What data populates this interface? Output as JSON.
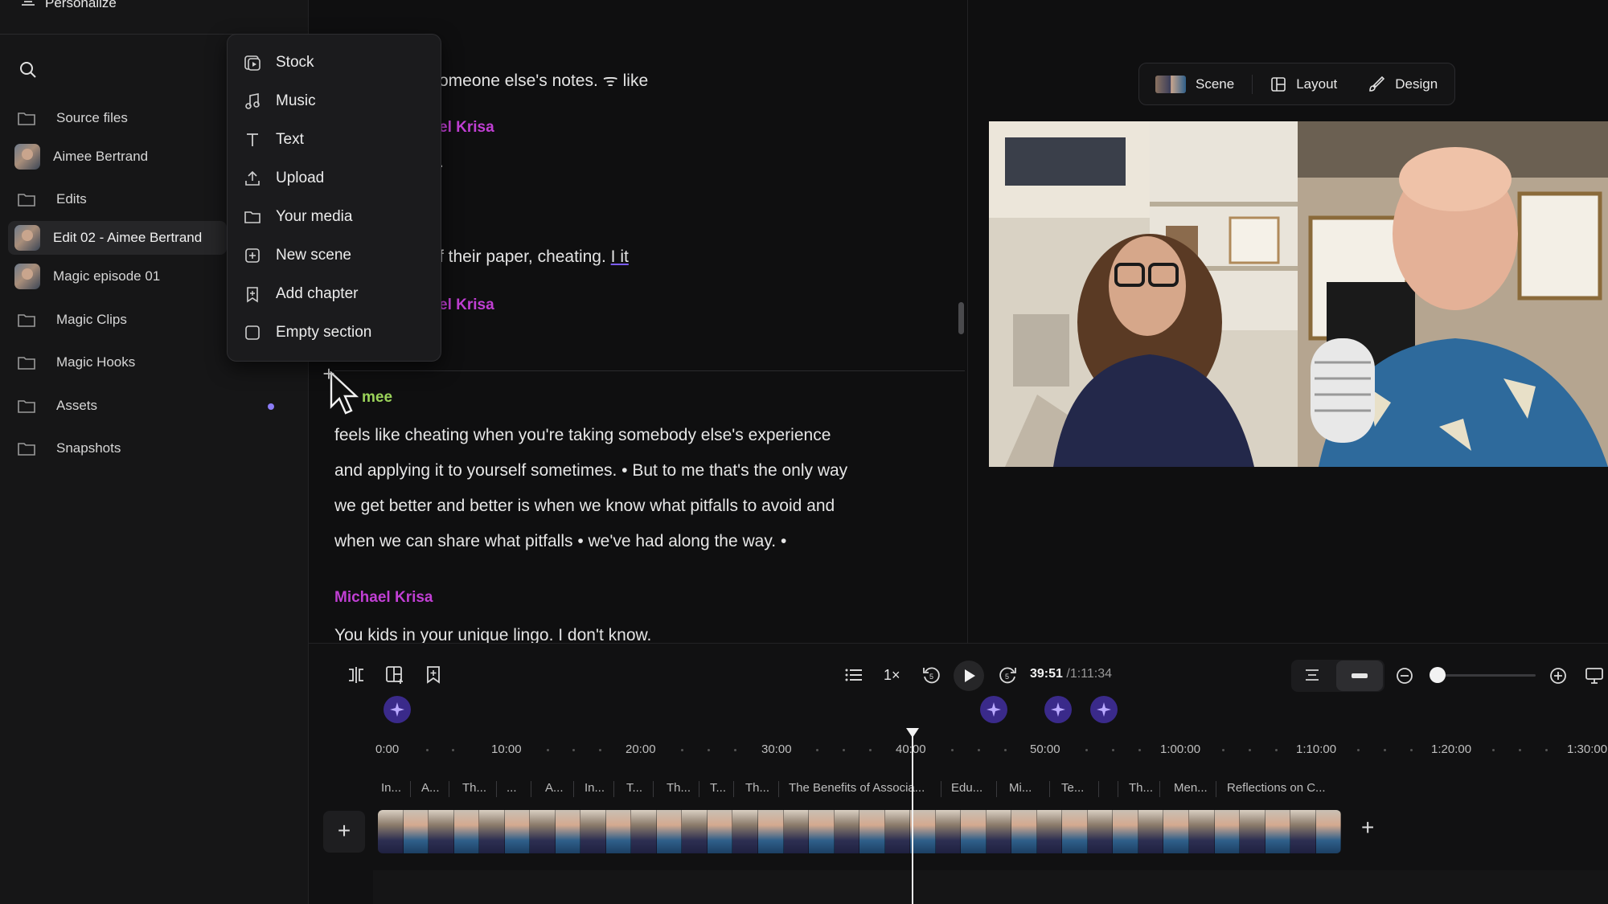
{
  "sidebar": {
    "top_label": "Personalize",
    "items": [
      {
        "label": "Source files",
        "type": "folder"
      },
      {
        "label": "Aimee Bertrand",
        "type": "avatar"
      },
      {
        "label": "Edits",
        "type": "folder"
      },
      {
        "label": "Edit 02 - Aimee Bertrand",
        "type": "avatar",
        "selected": true
      },
      {
        "label": "Magic episode 01",
        "type": "avatar"
      },
      {
        "label": "Magic Clips",
        "type": "folder"
      },
      {
        "label": "Magic Hooks",
        "type": "folder"
      },
      {
        "label": "Assets",
        "type": "folder"
      },
      {
        "label": "Snapshots",
        "type": "folder"
      }
    ]
  },
  "insert_menu": {
    "items": [
      {
        "label": "Stock",
        "icon": "stock-icon"
      },
      {
        "label": "Music",
        "icon": "music-icon"
      },
      {
        "label": "Text",
        "icon": "text-icon"
      },
      {
        "label": "Upload",
        "icon": "upload-icon"
      },
      {
        "label": "Your media",
        "icon": "folder-icon"
      },
      {
        "label": "New scene",
        "icon": "new-scene-icon"
      },
      {
        "label": "Add chapter",
        "icon": "bookmark-icon"
      },
      {
        "label": "Empty section",
        "icon": "square-icon"
      }
    ]
  },
  "transcript": {
    "line1": "omeone else's notes. ᯤ like",
    "speaker1": "el Krisa",
    "line2": ".",
    "line3": "f their paper, cheating.",
    "line3_tail": "I it",
    "speaker2": "el Krisa",
    "speaker3": "mee",
    "para1": [
      "feels like cheating when you're taking somebody else's experience",
      "and applying it to yourself sometimes. • But to me that's the only way",
      "we get better and better is when we know what pitfalls to avoid and",
      "when we can share what pitfalls • we've had along the way. •"
    ],
    "speaker4": "Michael Krisa",
    "para2": "You kids in your unique lingo. I don't know."
  },
  "preview_toolbar": {
    "scene": "Scene",
    "layout": "Layout",
    "design": "Design"
  },
  "playback": {
    "speed": "1×",
    "current": "39:51",
    "total": "/1:11:34"
  },
  "ruler": [
    "0:00",
    "10:00",
    "20:00",
    "30:00",
    "40:00",
    "50:00",
    "1:00:00",
    "1:10:00",
    "1:20:00",
    "1:30:00"
  ],
  "chapters": [
    "In...",
    "A...",
    "Th...",
    "...",
    "A...",
    "In...",
    "T...",
    "Th...",
    "T...",
    "Th...",
    "The Benefits of Associa...",
    "Edu...",
    "Mi...",
    "Te...",
    "Th...",
    "Men...",
    "Reflections on C..."
  ],
  "colors": {
    "speaker_purple": "#c13fd4",
    "speaker_green": "#9bd35a",
    "accent": "#8b7cf6"
  }
}
